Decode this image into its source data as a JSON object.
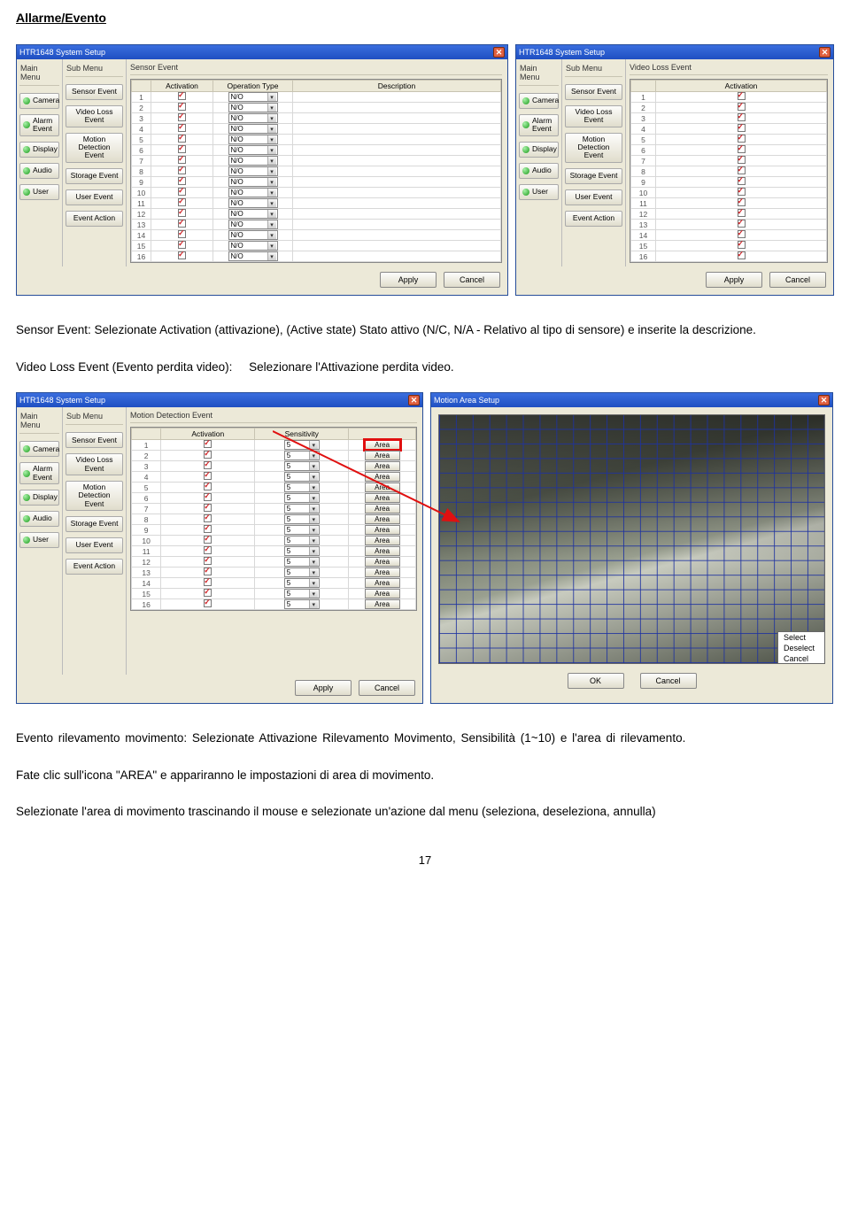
{
  "doc": {
    "heading": "Allarme/Evento",
    "para1": "Sensor Event: Selezionate Activation (attivazione), (Active state) Stato attivo (N/C, N/A - Relativo al tipo di sensore) e inserite la descrizione.",
    "para2a": "Video Loss Event (Evento perdita video):",
    "para2b": "Selezionare l'Attivazione perdita video.",
    "para3": "Evento rilevamento movimento: Selezionate Attivazione Rilevamento Movimento, Sensibilità (1~10) e l'area di rilevamento.",
    "para4": "Fate clic sull'icona \"AREA\" e appariranno le impostazioni di area di movimento.",
    "para5": "Selezionate l'area di movimento trascinando il mouse e selezionate un'azione dal menu (seleziona, deseleziona, annulla)",
    "page": "17"
  },
  "win": {
    "title": "HTR1648 System Setup",
    "mainmenu_label": "Main Menu",
    "submenu_label": "Sub Menu",
    "mainmenu": [
      "Camera",
      "Alarm Event",
      "Display",
      "Audio",
      "User"
    ],
    "submenu": [
      "Sensor Event",
      "Video Loss Event",
      "Motion Detection Event",
      "Storage Event",
      "User Event",
      "Event Action"
    ],
    "apply": "Apply",
    "cancel": "Cancel"
  },
  "sensor": {
    "header": "Sensor Event",
    "cols": [
      "",
      "Activation",
      "Operation Type",
      "Description"
    ],
    "optype": "N/O",
    "rows": 16
  },
  "vloss": {
    "header": "Video Loss Event",
    "cols": [
      "",
      "Activation"
    ],
    "rows": 16
  },
  "motion": {
    "header": "Motion Detection Event",
    "cols": [
      "",
      "Activation",
      "Sensitivity",
      ""
    ],
    "sens": "5",
    "area": "Area",
    "rows": 16
  },
  "motionarea": {
    "title": "Motion Area Setup",
    "menu": [
      "Select",
      "Deselect",
      "Cancel"
    ],
    "ok": "OK",
    "cancel": "Cancel"
  }
}
